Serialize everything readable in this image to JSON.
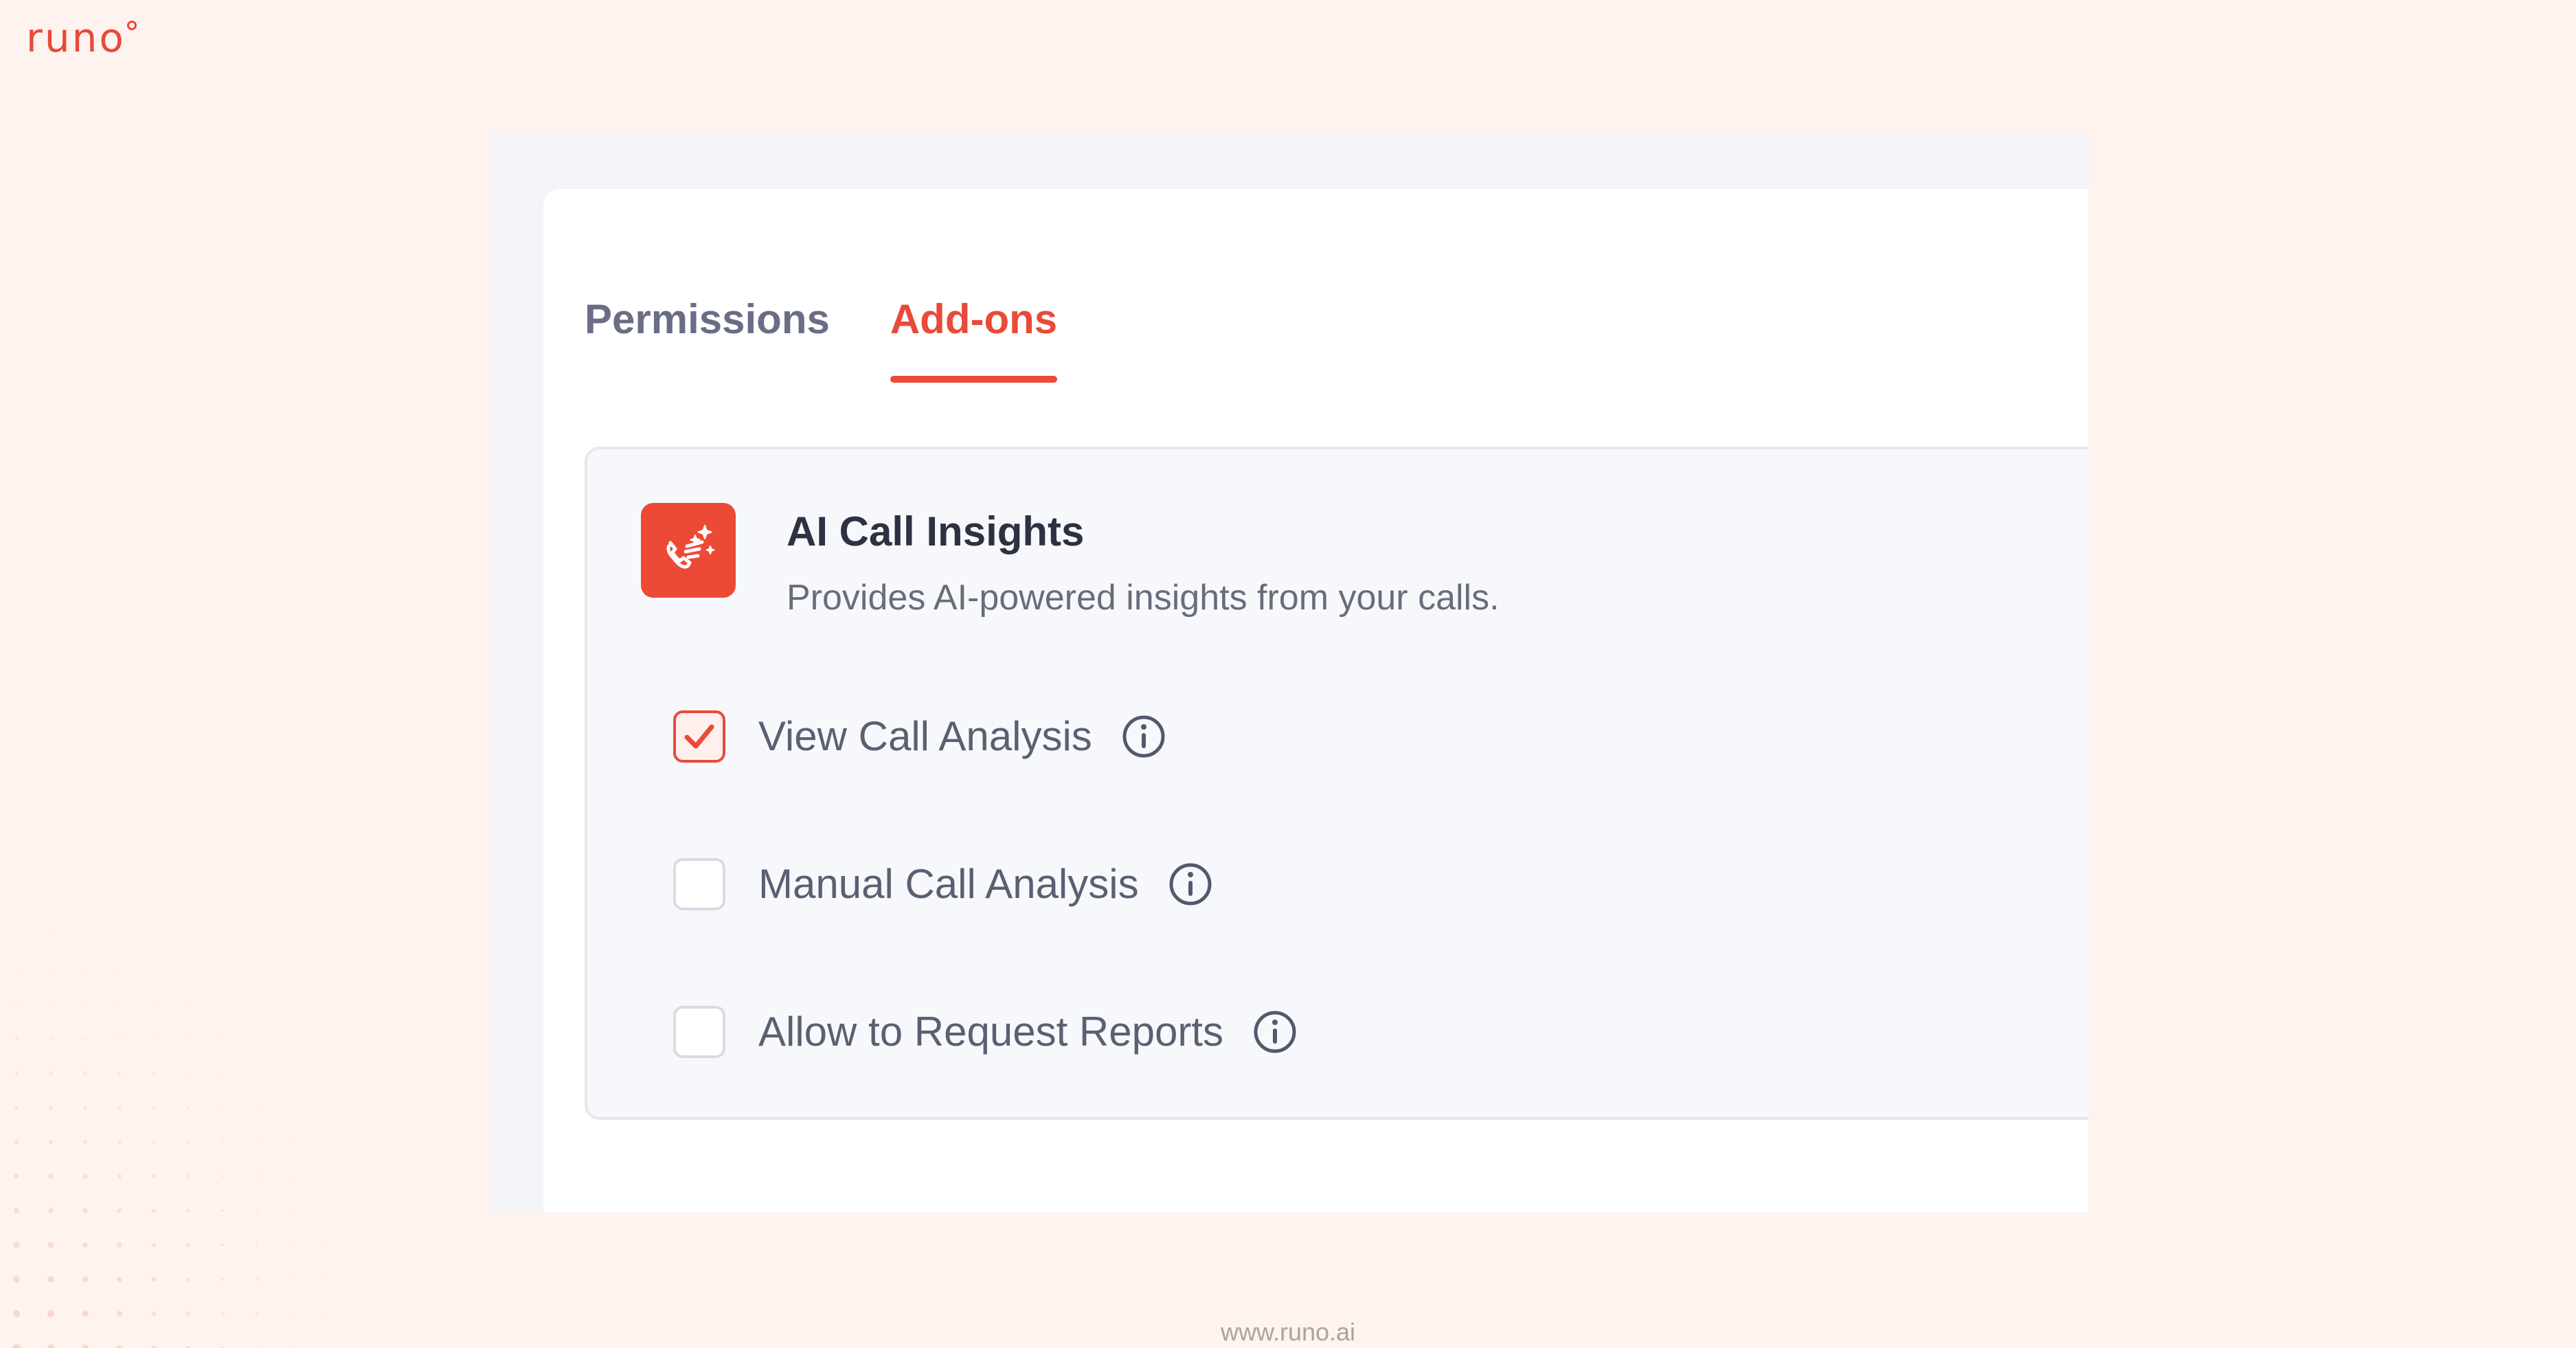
{
  "brand": {
    "name": "runo",
    "color": "#e8493a"
  },
  "tabs": [
    {
      "label": "Permissions",
      "active": false
    },
    {
      "label": "Add-ons",
      "active": true
    }
  ],
  "addon": {
    "icon": "ai-call-sparkle-icon",
    "title": "AI Call Insights",
    "description": "Provides AI-powered insights from your calls.",
    "options": [
      {
        "label": "View Call Analysis",
        "checked": true
      },
      {
        "label": "Manual Call Analysis",
        "checked": false
      },
      {
        "label": "Allow to Request Reports",
        "checked": false
      }
    ]
  },
  "footer": {
    "url": "www.runo.ai"
  },
  "colors": {
    "accent": "#ea4a39",
    "background": "#fef3ef",
    "panel": "#f3f3f8"
  }
}
